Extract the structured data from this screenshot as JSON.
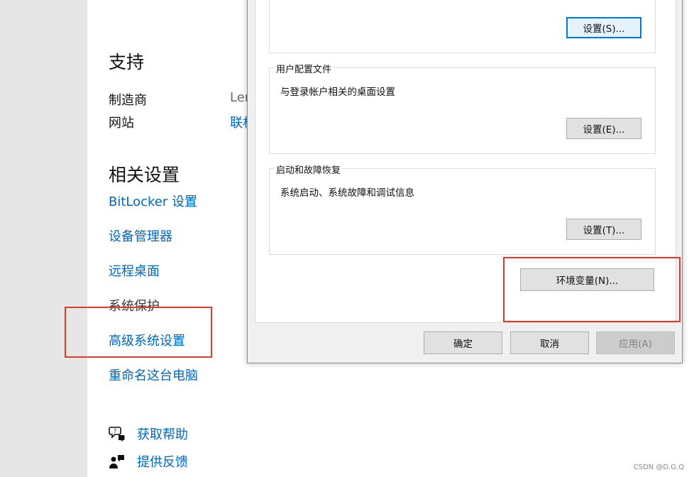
{
  "support": {
    "heading": "支持",
    "manufacturer_label": "制造商",
    "manufacturer_value": "Ler",
    "website_label": "网站",
    "website_value": "联机"
  },
  "related": {
    "heading": "相关设置",
    "links": [
      "BitLocker 设置",
      "设备管理器",
      "远程桌面",
      "系统保护",
      "高级系统设置",
      "重命名这台电脑"
    ]
  },
  "help": {
    "get_help": "获取帮助",
    "feedback": "提供反馈"
  },
  "dialog": {
    "perf_settings_btn": "设置(S)...",
    "profiles": {
      "title": "用户配置文件",
      "desc": "与登录帐户相关的桌面设置",
      "btn": "设置(E)..."
    },
    "startup": {
      "title": "启动和故障恢复",
      "desc": "系统启动、系统故障和调试信息",
      "btn": "设置(T)..."
    },
    "env_btn": "环境变量(N)...",
    "ok_btn": "确定",
    "cancel_btn": "取消",
    "apply_btn": "应用(A)"
  },
  "watermark": "CSDN @D.G.Q",
  "colors": {
    "link": "#0067c0",
    "highlight": "#e03a2a",
    "focus": "#0078d7"
  }
}
